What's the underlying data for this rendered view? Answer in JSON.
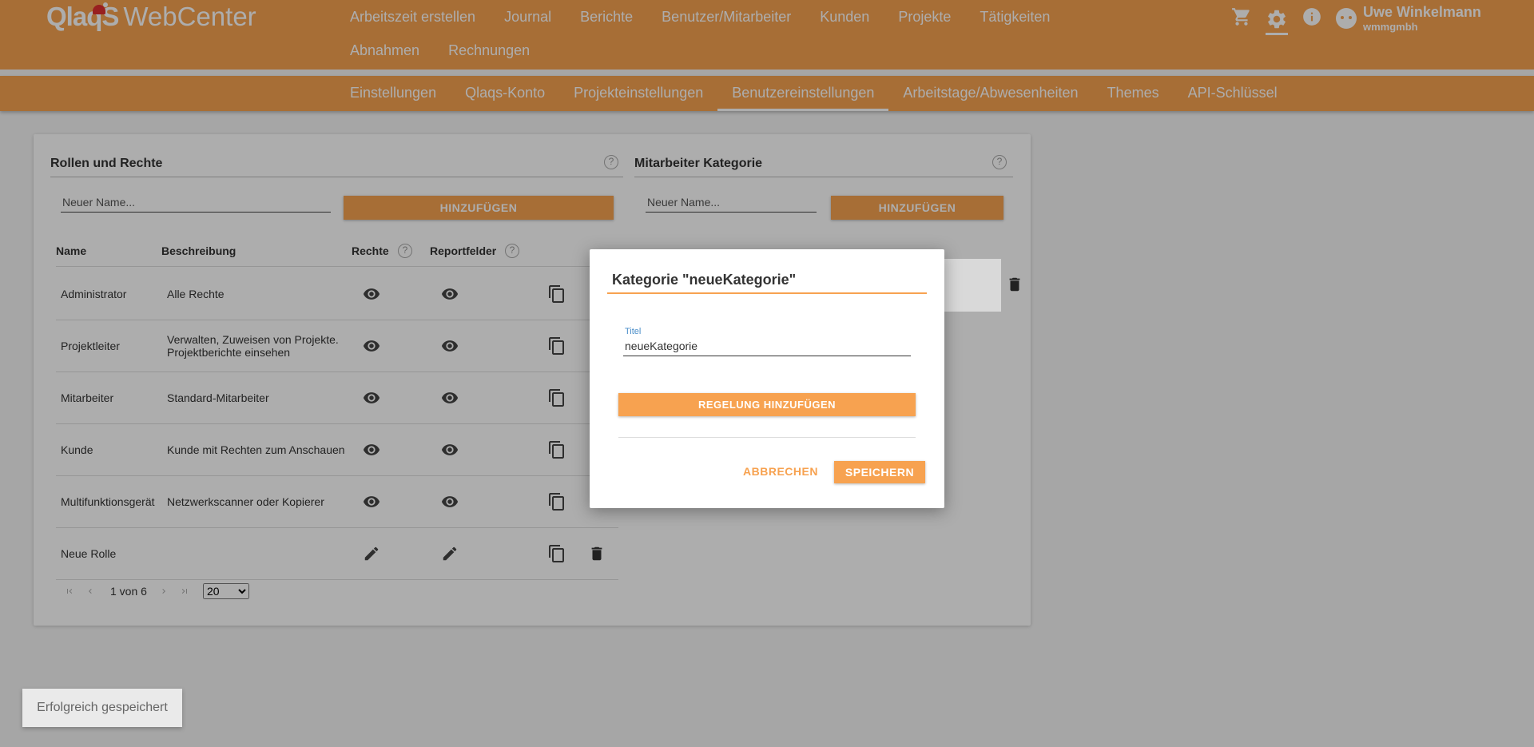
{
  "app": {
    "logo": "QlaqS",
    "product": "WebCenter"
  },
  "mainnav": {
    "row1": [
      "Arbeitszeit erstellen",
      "Journal",
      "Berichte",
      "Benutzer/Mitarbeiter",
      "Kunden",
      "Projekte",
      "Tätigkeiten"
    ],
    "row2": [
      "Abnahmen",
      "Rechnungen"
    ]
  },
  "header_icons": [
    "cart-icon",
    "gear-icon",
    "info-icon"
  ],
  "user": {
    "name": "Uwe Winkelmann",
    "org": "wmmgmbh"
  },
  "subnav": {
    "items": [
      "Einstellungen",
      "Qlaqs-Konto",
      "Projekteinstellungen",
      "Benutzereinstellungen",
      "Arbeitstage/Abwesenheiten",
      "Themes",
      "API-Schlüssel"
    ],
    "active": "Benutzereinstellungen"
  },
  "roles": {
    "title": "Rollen und Rechte",
    "input_placeholder": "Neuer Name...",
    "add_label": "HINZUFÜGEN",
    "headers": {
      "name": "Name",
      "description": "Beschreibung",
      "rights": "Rechte",
      "reportfields": "Reportfelder"
    },
    "rows": [
      {
        "name": "Administrator",
        "description": "Alle Rechte",
        "rights_icon": "eye-icon",
        "report_icon": "eye-icon",
        "deletable": false
      },
      {
        "name": "Projektleiter",
        "description": "Verwalten, Zuweisen von Projekte. Projektberichte einsehen",
        "rights_icon": "eye-icon",
        "report_icon": "eye-icon",
        "deletable": false
      },
      {
        "name": "Mitarbeiter",
        "description": "Standard-Mitarbeiter",
        "rights_icon": "eye-icon",
        "report_icon": "eye-icon",
        "deletable": false
      },
      {
        "name": "Kunde",
        "description": "Kunde mit Rechten zum Anschauen",
        "rights_icon": "eye-icon",
        "report_icon": "eye-icon",
        "deletable": false
      },
      {
        "name": "Multifunktionsgerät",
        "description": "Netzwerkscanner oder Kopierer",
        "rights_icon": "eye-icon",
        "report_icon": "eye-icon",
        "deletable": false
      },
      {
        "name": "Neue Rolle",
        "description": "",
        "rights_icon": "pencil-icon",
        "report_icon": "pencil-icon",
        "deletable": true
      }
    ],
    "pager": {
      "label": "1 von 6",
      "page_size": "20",
      "options": [
        "20"
      ]
    }
  },
  "categories": {
    "title": "Mitarbeiter Kategorie",
    "input_placeholder": "Neuer Name...",
    "add_label": "HINZUFÜGEN"
  },
  "dialog": {
    "title": "Kategorie \"neueKategorie\"",
    "field_label": "Titel",
    "field_value": "neueKategorie",
    "add_rule_label": "REGELUNG HINZUFÜGEN",
    "cancel_label": "ABBRECHEN",
    "save_label": "SPEICHERN"
  },
  "toast": {
    "message": "Erfolgreich gespeichert"
  },
  "colors": {
    "accent": "#f7a250",
    "label_blue": "#4a8ec9"
  }
}
